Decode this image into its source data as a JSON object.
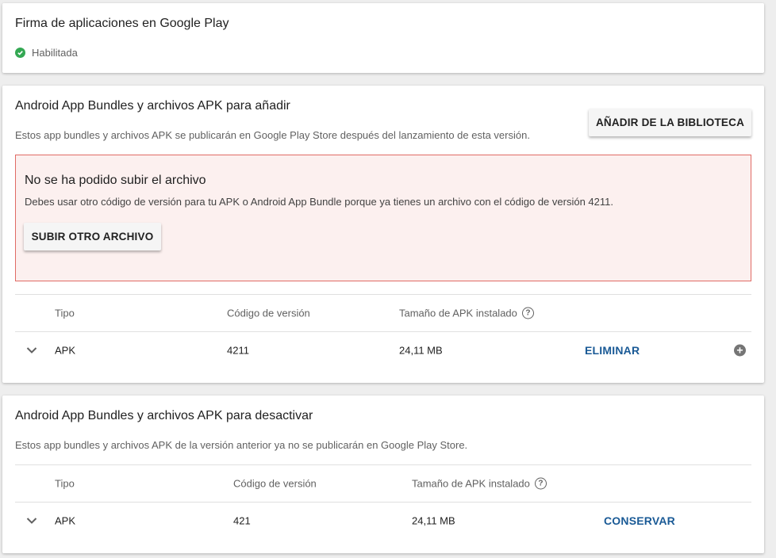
{
  "signing": {
    "title": "Firma de aplicaciones en Google Play",
    "status": "Habilitada",
    "status_color": "#34a853"
  },
  "add_section": {
    "title": "Android App Bundles y archivos APK para añadir",
    "description": "Estos app bundles y archivos APK se publicarán en Google Play Store después del lanzamiento de esta versión.",
    "library_button": "AÑADIR DE LA BIBLIOTECA",
    "error": {
      "title": "No se ha podido subir el archivo",
      "message": "Debes usar otro código de versión para tu APK o Android App Bundle porque ya tienes un archivo con el código de versión 4211.",
      "retry_button": "SUBIR OTRO ARCHIVO",
      "border_color": "#e06b65",
      "background_color": "#fcf0ef"
    },
    "table": {
      "headers": [
        "Tipo",
        "Código de versión",
        "Tamaño de APK instalado"
      ],
      "help_icon": "help-circle-icon",
      "rows": [
        {
          "type": "APK",
          "version_code": "4211",
          "size": "24,11 MB",
          "action": "ELIMINAR"
        }
      ]
    }
  },
  "deactivate_section": {
    "title": "Android App Bundles y archivos APK para desactivar",
    "description": "Estos app bundles y archivos APK de la versión anterior ya no se publicarán en Google Play Store.",
    "table": {
      "headers": [
        "Tipo",
        "Código de versión",
        "Tamaño de APK instalado"
      ],
      "help_icon": "help-circle-icon",
      "rows": [
        {
          "type": "APK",
          "version_code": "421",
          "size": "24,11 MB",
          "action": "CONSERVAR"
        }
      ]
    }
  },
  "colors": {
    "link": "#1a5a96",
    "page_background": "#eeeeee"
  }
}
